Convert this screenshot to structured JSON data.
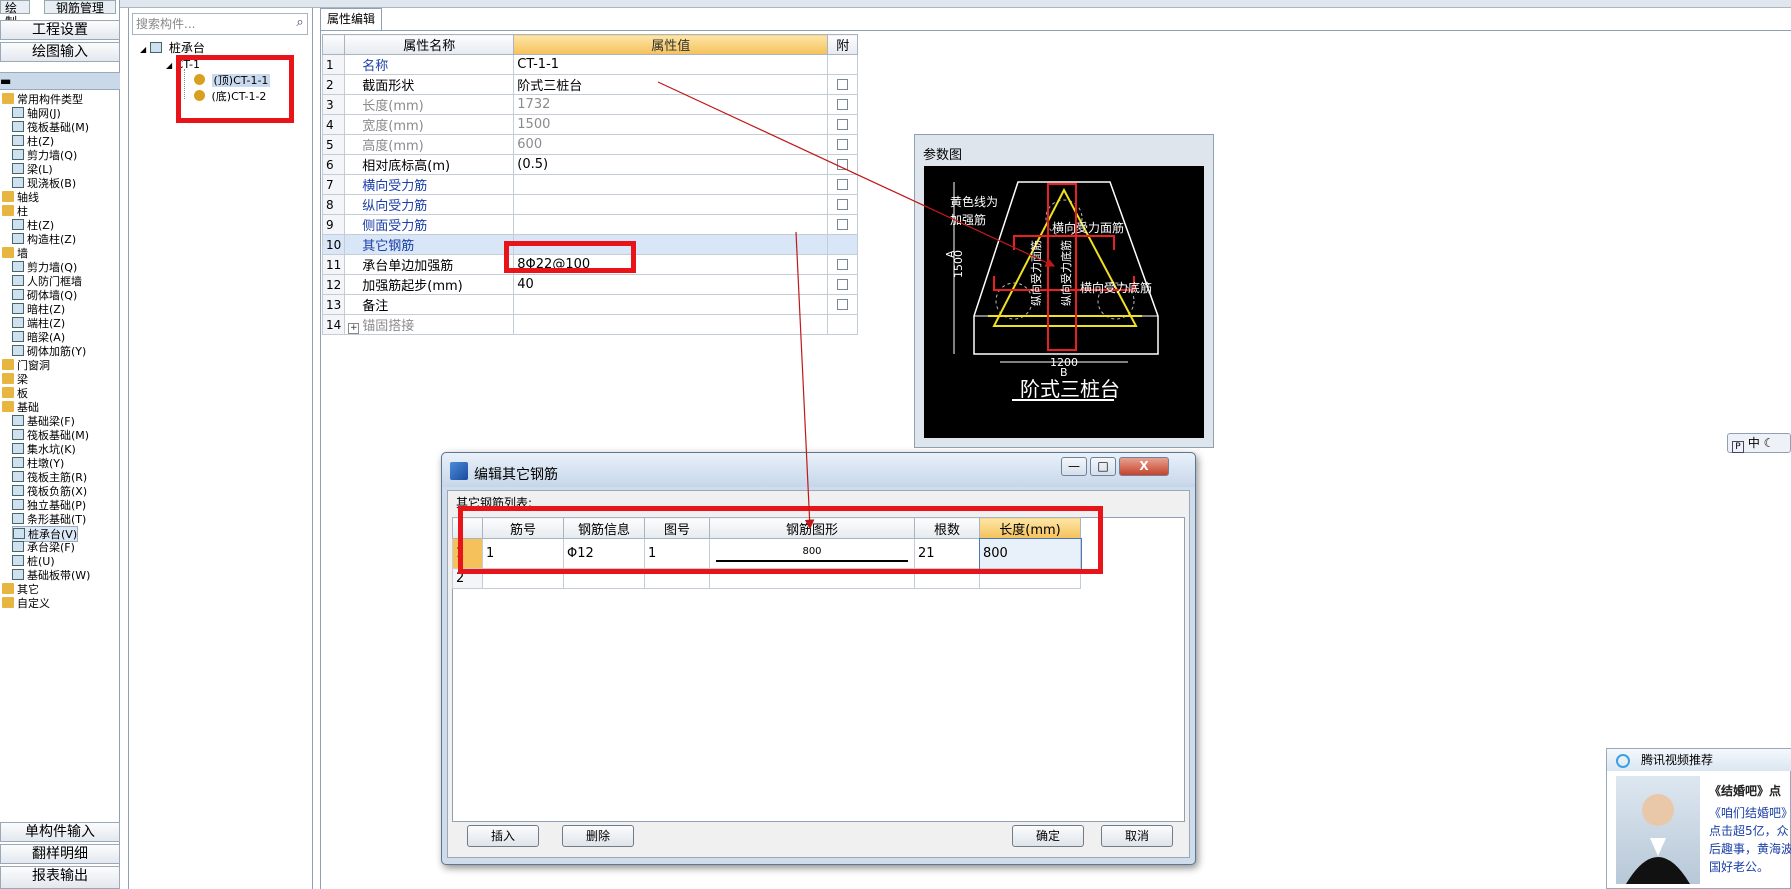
{
  "left_nav": {
    "tabs": [
      "绘制",
      "钢筋管理"
    ],
    "top_buttons": [
      "工程设置",
      "绘图输入"
    ],
    "bottom_buttons": [
      "单构件输入",
      "翻样明细",
      "报表输出"
    ],
    "tree": [
      {
        "label": "常用构件类型",
        "level": 0,
        "type": "folder"
      },
      {
        "label": "轴网(J)",
        "level": 1
      },
      {
        "label": "筏板基础(M)",
        "level": 1
      },
      {
        "label": "柱(Z)",
        "level": 1
      },
      {
        "label": "剪力墙(Q)",
        "level": 1
      },
      {
        "label": "梁(L)",
        "level": 1
      },
      {
        "label": "现浇板(B)",
        "level": 1
      },
      {
        "label": "轴线",
        "level": 0,
        "type": "folder"
      },
      {
        "label": "柱",
        "level": 0,
        "type": "folder"
      },
      {
        "label": "柱(Z)",
        "level": 1
      },
      {
        "label": "构造柱(Z)",
        "level": 1
      },
      {
        "label": "墙",
        "level": 0,
        "type": "folder"
      },
      {
        "label": "剪力墙(Q)",
        "level": 1
      },
      {
        "label": "人防门框墙",
        "level": 1
      },
      {
        "label": "砌体墙(Q)",
        "level": 1
      },
      {
        "label": "暗柱(Z)",
        "level": 1
      },
      {
        "label": "端柱(Z)",
        "level": 1
      },
      {
        "label": "暗梁(A)",
        "level": 1
      },
      {
        "label": "砌体加筋(Y)",
        "level": 1
      },
      {
        "label": "门窗洞",
        "level": 0,
        "type": "folder"
      },
      {
        "label": "梁",
        "level": 0,
        "type": "folder"
      },
      {
        "label": "板",
        "level": 0,
        "type": "folder"
      },
      {
        "label": "基础",
        "level": 0,
        "type": "folder"
      },
      {
        "label": "基础梁(F)",
        "level": 1
      },
      {
        "label": "筏板基础(M)",
        "level": 1
      },
      {
        "label": "集水坑(K)",
        "level": 1
      },
      {
        "label": "柱墩(Y)",
        "level": 1
      },
      {
        "label": "筏板主筋(R)",
        "level": 1
      },
      {
        "label": "筏板负筋(X)",
        "level": 1
      },
      {
        "label": "独立基础(P)",
        "level": 1
      },
      {
        "label": "条形基础(T)",
        "level": 1
      },
      {
        "label": "桩承台(V)",
        "level": 1,
        "selected": true
      },
      {
        "label": "承台梁(F)",
        "level": 1
      },
      {
        "label": "桩(U)",
        "level": 1
      },
      {
        "label": "基础板带(W)",
        "level": 1
      },
      {
        "label": "其它",
        "level": 0,
        "type": "folder"
      },
      {
        "label": "自定义",
        "level": 0,
        "type": "folder"
      }
    ]
  },
  "component_tree": {
    "search_placeholder": "搜索构件...",
    "root": "桩承台",
    "group": "CT-1",
    "children": [
      "(顶)CT-1-1",
      "(底)CT-1-2"
    ]
  },
  "property_grid": {
    "tab": "属性编辑",
    "headers": [
      "属性名称",
      "属性值",
      "附"
    ],
    "rows": [
      {
        "num": "1",
        "name": "名称",
        "value": "CT-1-1",
        "style": "blue",
        "check": false
      },
      {
        "num": "2",
        "name": "截面形状",
        "value": "阶式三桩台",
        "style": "normal",
        "check": true
      },
      {
        "num": "3",
        "name": "长度(mm)",
        "value": "1732",
        "style": "gray",
        "check": true
      },
      {
        "num": "4",
        "name": "宽度(mm)",
        "value": "1500",
        "style": "gray",
        "check": true
      },
      {
        "num": "5",
        "name": "高度(mm)",
        "value": "600",
        "style": "gray",
        "check": true
      },
      {
        "num": "6",
        "name": "相对底标高(m)",
        "value": "(0.5)",
        "style": "normal",
        "check": true
      },
      {
        "num": "7",
        "name": "横向受力筋",
        "value": "",
        "style": "blue",
        "check": true
      },
      {
        "num": "8",
        "name": "纵向受力筋",
        "value": "",
        "style": "blue",
        "check": true
      },
      {
        "num": "9",
        "name": "侧面受力筋",
        "value": "",
        "style": "blue",
        "check": true
      },
      {
        "num": "10",
        "name": "其它钢筋",
        "value": "",
        "style": "blue",
        "check": false,
        "selected": true
      },
      {
        "num": "11",
        "name": "承台单边加强筋",
        "value": "8Φ22@100",
        "style": "normal",
        "check": true
      },
      {
        "num": "12",
        "name": "加强筋起步(mm)",
        "value": "40",
        "style": "normal",
        "check": true
      },
      {
        "num": "13",
        "name": "备注",
        "value": "",
        "style": "normal",
        "check": true
      },
      {
        "num": "14",
        "name": "锚固搭接",
        "value": "",
        "style": "gray",
        "check": false,
        "expand": "+"
      }
    ]
  },
  "param_panel": {
    "title": "参数图",
    "texts": {
      "yellow_note_1": "黄色线为",
      "yellow_note_2": "加强筋",
      "top_bar": "横向受力面筋",
      "bottom_bar": "横向受力底筋",
      "vert_top": "纵向受力面筋",
      "vert_bottom": "纵向受力底筋",
      "dim_a_label": "A",
      "dim_a_value": "1500",
      "dim_b_value": "1200",
      "dim_b_label": "B",
      "caption": "阶式三桩台"
    }
  },
  "dialog": {
    "title": "编辑其它钢筋",
    "list_label": "其它钢筋列表:",
    "headers": [
      "筋号",
      "钢筋信息",
      "图号",
      "钢筋图形",
      "根数",
      "长度(mm)"
    ],
    "rows": [
      {
        "num": "1",
        "bar_no": "1",
        "info": "Φ12",
        "fig_no": "1",
        "shape_len": "800",
        "count": "21",
        "length": "800"
      },
      {
        "num": "2",
        "bar_no": "",
        "info": "",
        "fig_no": "",
        "shape_len": "",
        "count": "",
        "length": ""
      }
    ],
    "buttons": {
      "insert": "插入",
      "delete": "删除",
      "ok": "确定",
      "cancel": "取消"
    },
    "win": {
      "min": "—",
      "max": "□",
      "close": "X"
    }
  },
  "ime": {
    "text": "中"
  },
  "toast": {
    "title": "腾讯视频推荐",
    "lines": [
      "《结婚吧》点",
      "《咱们结婚吧》",
      "点击超5亿，众",
      "后趣事，黄海波",
      "国好老公。"
    ]
  }
}
